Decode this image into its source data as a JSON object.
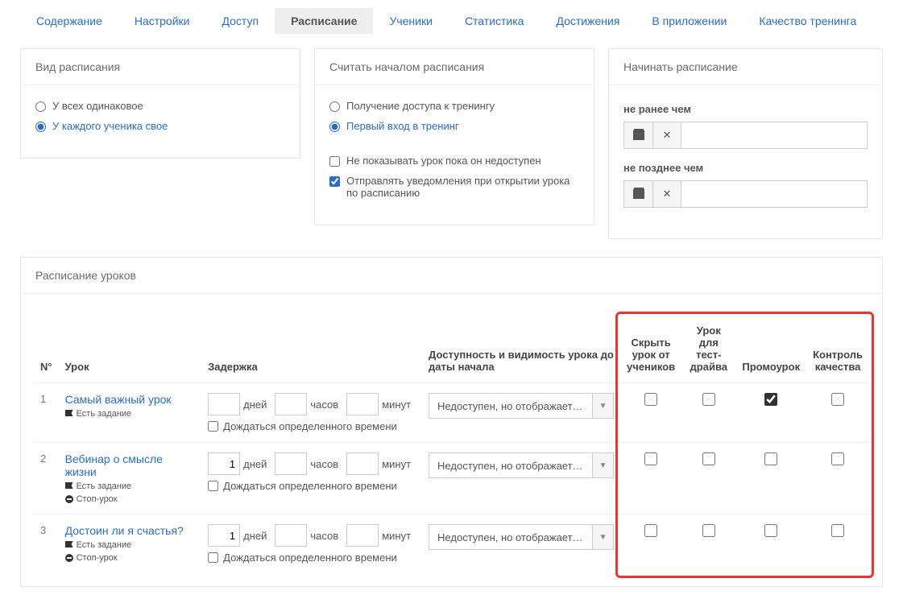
{
  "tabs": [
    {
      "label": "Содержание",
      "active": false
    },
    {
      "label": "Настройки",
      "active": false
    },
    {
      "label": "Доступ",
      "active": false
    },
    {
      "label": "Расписание",
      "active": true
    },
    {
      "label": "Ученики",
      "active": false
    },
    {
      "label": "Статистика",
      "active": false
    },
    {
      "label": "Достижения",
      "active": false
    },
    {
      "label": "В приложении",
      "active": false
    },
    {
      "label": "Качество тренинга",
      "active": false
    }
  ],
  "panel1": {
    "title": "Вид расписания",
    "opt1": "У всех одинаковое",
    "opt2": "У каждого ученика свое"
  },
  "panel2": {
    "title": "Считать началом расписания",
    "opt1": "Получение доступа к тренингу",
    "opt2": "Первый вход в тренинг",
    "chk1": "Не показывать урок пока он недоступен",
    "chk2": "Отправлять уведомления при открытии урока по расписанию"
  },
  "panel3": {
    "title": "Начинать расписание",
    "label1": "не ранее чем",
    "label2": "не позднее чем"
  },
  "schedule": {
    "title": "Расписание уроков",
    "headers": {
      "num": "N°",
      "lesson": "Урок",
      "delay": "Задержка",
      "avail": "Доступность и видимость урока до даты начала",
      "hide": "Скрыть урок от учеников",
      "test": "Урок для тест-драйва",
      "promo": "Промоурок",
      "qc": "Контроль качества"
    },
    "unitDays": "дней",
    "unitHours": "часов",
    "unitMinutes": "минут",
    "waitLabel": "Дождаться определенного времени",
    "availText": "Недоступен, но отображает…",
    "taskLabel": "Есть задание",
    "stopLabel": "Стоп-урок",
    "rows": [
      {
        "num": "1",
        "title": "Самый важный урок",
        "days": "",
        "hasTask": true,
        "hasStop": false,
        "hide": false,
        "test": false,
        "promo": true,
        "qc": false
      },
      {
        "num": "2",
        "title": "Вебинар о смысле жизни",
        "days": "1",
        "hasTask": true,
        "hasStop": true,
        "hide": false,
        "test": false,
        "promo": false,
        "qc": false
      },
      {
        "num": "3",
        "title": "Достоин ли я счастья?",
        "days": "1",
        "hasTask": true,
        "hasStop": true,
        "hide": false,
        "test": false,
        "promo": false,
        "qc": false
      }
    ]
  }
}
